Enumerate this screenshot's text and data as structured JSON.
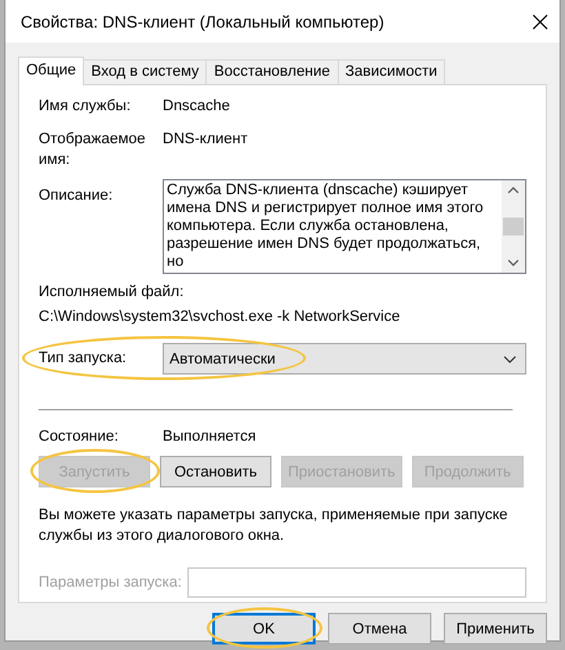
{
  "window": {
    "title": "Свойства: DNS-клиент (Локальный компьютер)"
  },
  "tabs": [
    {
      "label": "Общие",
      "selected": true
    },
    {
      "label": "Вход в систему",
      "selected": false
    },
    {
      "label": "Восстановление",
      "selected": false
    },
    {
      "label": "Зависимости",
      "selected": false
    }
  ],
  "general": {
    "service_name": {
      "label": "Имя службы:",
      "value": "Dnscache"
    },
    "display_name": {
      "label": "Отображаемое имя:",
      "value": "DNS-клиент"
    },
    "description": {
      "label": "Описание:",
      "value": "Служба DNS-клиента (dnscache) кэширует имена DNS и регистрирует полное имя этого компьютера. Если служба остановлена, разрешение имен DNS будет продолжаться, но"
    },
    "executable": {
      "label": "Исполняемый файл:",
      "value": "C:\\Windows\\system32\\svchost.exe -k NetworkService"
    },
    "startup_type": {
      "label": "Тип запуска:",
      "value": "Автоматически",
      "highlighted": true
    },
    "status": {
      "label": "Состояние:",
      "value": "Выполняется"
    },
    "service_buttons": [
      {
        "label": "Запустить",
        "disabled": true,
        "highlighted": true
      },
      {
        "label": "Остановить",
        "disabled": false,
        "highlighted": false
      },
      {
        "label": "Приостановить",
        "disabled": true,
        "highlighted": false
      },
      {
        "label": "Продолжить",
        "disabled": true,
        "highlighted": false
      }
    ],
    "hint": "Вы можете указать параметры запуска, применяемые при запуске службы из этого диалогового окна.",
    "start_parameters": {
      "label": "Параметры запуска:",
      "disabled": true
    }
  },
  "dialog_buttons": [
    {
      "label": "OK",
      "default": true,
      "highlighted": true
    },
    {
      "label": "Отмена",
      "default": false,
      "highlighted": false
    },
    {
      "label": "Применить",
      "default": false,
      "highlighted": false
    }
  ]
}
